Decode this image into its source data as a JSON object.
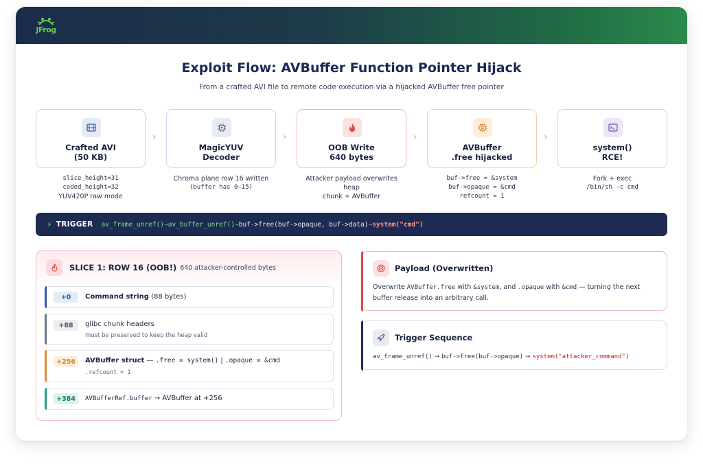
{
  "header": {
    "logo_text": "JFrog"
  },
  "title": "Exploit Flow: AVBuffer Function Pointer Hijack",
  "subtitle": "From a crafted AVI file to remote code execution via a hijacked AVBuffer free pointer",
  "steps": [
    {
      "icon": "film-icon",
      "label_line1": "Crafted AVI",
      "label_line2": "(50 KB)",
      "desc": [
        "slice_height=31",
        "coded_height=32",
        "YUV420P raw mode"
      ],
      "border": "#c9d7ec",
      "icon_bg": "#e3ebf7",
      "icon_color": "#3d5fa0"
    },
    {
      "icon": "chip-icon",
      "label_line1": "MagicYUV",
      "label_line2": "Decoder",
      "desc": [
        "Chroma plane row 16 written",
        "(buffer has 0–15)"
      ],
      "border": "#c9d7ec",
      "icon_bg": "#e7ebf2",
      "icon_color": "#5a647a"
    },
    {
      "icon": "flame-icon",
      "label_line1": "OOB Write",
      "label_line2": "640 bytes",
      "desc": [
        "Attacker payload overwrites heap",
        "chunk + AVBuffer"
      ],
      "border": "#f2b9bd",
      "icon_bg": "#fbe1e2",
      "icon_color": "#d94a4a"
    },
    {
      "icon": "gear-icon",
      "label_line1": "AVBuffer",
      "label_line2": ".free hijacked",
      "desc": [
        "buf->free = &system",
        "buf->opaque = &cmd",
        "refcount = 1"
      ],
      "border": "#f3d2a8",
      "icon_bg": "#fdeedb",
      "icon_color": "#d9862a"
    },
    {
      "icon": "terminal-icon",
      "label_line1": "system()",
      "label_line2": "RCE!",
      "desc": [
        "Fork + exec",
        "/bin/sh -c cmd"
      ],
      "border": "#d8cdee",
      "icon_bg": "#ece6f7",
      "icon_color": "#6b4fb0"
    }
  ],
  "trigger": {
    "label": "TRIGGER",
    "f1": "av_frame_unref()",
    "f2": "av_buffer_unref()",
    "f3": "buf->free(buf->opaque, buf->data)",
    "f4": "system(\"cmd\")",
    "arrow": "→"
  },
  "slice": {
    "heading": "SLICE 1: ROW 16 (OOB!)",
    "subheading": "640 attacker-controlled bytes",
    "rows": [
      {
        "offset": "+0",
        "title": "Command string",
        "tail": " (88 bytes)",
        "bar": "#2d5aa8",
        "off_bg": "#e3ebf7",
        "off_color": "#2d5aa8"
      },
      {
        "offset": "+88",
        "title": "glibc chunk headers",
        "sub": "must be preserved to keep the heap valid",
        "bar": "#6b7488",
        "off_bg": "#eceef2",
        "off_color": "#4a5368"
      },
      {
        "offset": "+256",
        "title": "AVBuffer struct",
        "dash": " — ",
        "code1": ".free = system()",
        "sep": " | ",
        "code2": ".opaque = &cmd",
        "sub": ".refcount = 1",
        "bar": "#e08a2a",
        "off_bg": "#fdeedb",
        "off_color": "#d9862a"
      },
      {
        "offset": "+384",
        "code": "AVBufferRef.buffer",
        "arrow": " → ",
        "title": "AVBuffer at +256",
        "bar": "#1e9e8a",
        "off_bg": "#dcf3ee",
        "off_color": "#16806f"
      }
    ]
  },
  "payload": {
    "heading": "Payload (Overwritten)",
    "t1": "Overwrite ",
    "c1": "AVBuffer.free",
    "t2": " with ",
    "c2": "&system",
    "t3": ", and ",
    "c3": ".opaque",
    "t4": " with ",
    "c4": "&cmd",
    "t5": " — turning the next buffer release into an arbitrary call."
  },
  "sequence": {
    "heading": "Trigger Sequence",
    "f1": "av_frame_unref()",
    "f2": "buf->free(buf->opaque)",
    "f3": "system(\"attacker_command\")",
    "arrow": " → "
  },
  "colors": {
    "accent_navy": "#1d2a52",
    "danger": "#d94a4a",
    "green": "#2a8a4a"
  }
}
